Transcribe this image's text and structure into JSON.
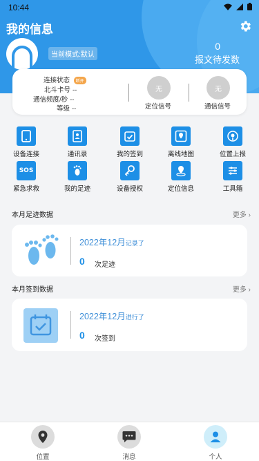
{
  "status_bar": {
    "time": "10:44"
  },
  "header": {
    "title": "我的信息",
    "mode": "当前模式:默认",
    "pending_count": "0",
    "pending_label": "报文待发数"
  },
  "info": {
    "connection_label": "连接状态",
    "connection_value": "断开",
    "beidou_label": "北斗卡号",
    "beidou_value": "--",
    "freq_label": "通信频度/秒",
    "freq_value": "--",
    "level_label": "等级",
    "level_value": "--",
    "position_signal_value": "无",
    "position_signal_label": "定位信号",
    "comm_signal_value": "无",
    "comm_signal_label": "通信信号"
  },
  "grid": [
    {
      "label": "设备连接",
      "icon": "device-icon"
    },
    {
      "label": "通讯录",
      "icon": "contacts-icon"
    },
    {
      "label": "我的签到",
      "icon": "checkin-icon"
    },
    {
      "label": "离线地图",
      "icon": "map-icon"
    },
    {
      "label": "位置上报",
      "icon": "location-report-icon"
    },
    {
      "label": "紧急求救",
      "icon": "sos-icon"
    },
    {
      "label": "我的足迹",
      "icon": "footprint-icon"
    },
    {
      "label": "设备授权",
      "icon": "key-icon"
    },
    {
      "label": "定位信息",
      "icon": "positioning-icon"
    },
    {
      "label": "工具箱",
      "icon": "toolbox-icon"
    }
  ],
  "footprint": {
    "section_title": "本月足迹数据",
    "more": "更多",
    "date": "2022年12月",
    "date_suffix": "记录了",
    "count": "0",
    "unit": "次足迹"
  },
  "checkin": {
    "section_title": "本月签到数据",
    "more": "更多",
    "date": "2022年12月",
    "date_suffix": "进行了",
    "count": "0",
    "unit": "次签到"
  },
  "nav": [
    {
      "label": "位置",
      "icon": "location-pin-icon"
    },
    {
      "label": "消息",
      "icon": "message-icon"
    },
    {
      "label": "个人",
      "icon": "person-icon"
    }
  ],
  "colors": {
    "primary": "#2f97e8",
    "icon_blue": "#1d8fe6",
    "badge_orange": "#f4a64b"
  }
}
